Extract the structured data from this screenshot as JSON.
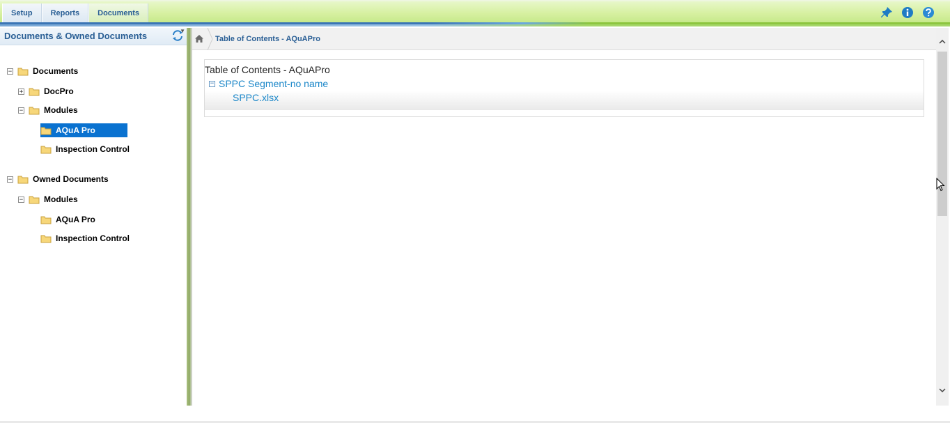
{
  "topbar": {
    "tabs": [
      {
        "label": "Setup"
      },
      {
        "label": "Reports"
      },
      {
        "label": "Documents"
      }
    ],
    "icons": [
      "pin-icon",
      "info-icon",
      "help-icon"
    ]
  },
  "left_panel": {
    "title": "Documents & Owned Documents",
    "refresh_icon": "refresh-icon",
    "tree": {
      "documents": {
        "label": "Documents",
        "toggle": "−",
        "children": {
          "docpro": {
            "label": "DocPro",
            "toggle": "+"
          },
          "modules": {
            "label": "Modules",
            "toggle": "−",
            "children": {
              "aquapro": {
                "label": "AQuA Pro",
                "selected": true
              },
              "inspection": {
                "label": "Inspection Control"
              }
            }
          }
        }
      },
      "owned": {
        "label": "Owned Documents",
        "toggle": "−",
        "children": {
          "modules": {
            "label": "Modules",
            "toggle": "−",
            "children": {
              "aquapro": {
                "label": "AQuA Pro"
              },
              "inspection": {
                "label": "Inspection Control"
              }
            }
          }
        }
      }
    }
  },
  "right_panel": {
    "breadcrumb": "Table of Contents - AQuAPro",
    "toc": {
      "title": "Table of Contents - AQuAPro",
      "segment_toggle": "−",
      "segment": "SPPC Segment-no name",
      "file": "SPPC.xlsx"
    }
  },
  "colors": {
    "accent_blue": "#2a5f95",
    "link_blue": "#1a86c8",
    "selection": "#0a72d0",
    "topbar_green": "#d6f0a0"
  }
}
